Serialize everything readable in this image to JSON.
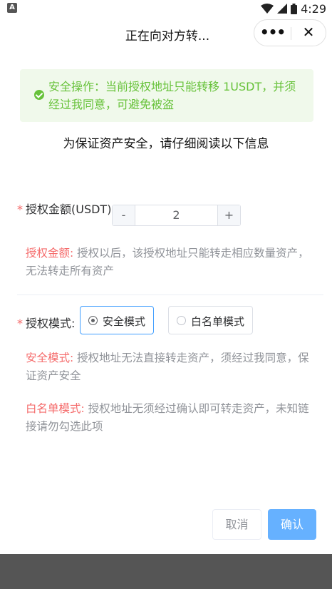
{
  "status_bar": {
    "time": "4:29"
  },
  "nav": {
    "title": "正在向对方转...",
    "more_icon": "more-icon",
    "close_icon": "close-icon"
  },
  "notice": {
    "text": "安全操作：当前授权地址只能转移 1USDT，并须经过我同意，可避免被盗",
    "icon": "check-circle-icon",
    "color": "#67c23a"
  },
  "subtitle": "为保证资产安全，请仔细阅读以下信息",
  "amount": {
    "required_mark": "*",
    "label": "授权金额(USDT):",
    "minus": "-",
    "plus": "+",
    "value": "2",
    "desc_highlight": "授权金额:",
    "desc_text": " 授权以后，该授权地址只能转走相应数量资产，无法转走所有资产"
  },
  "mode": {
    "required_mark": "*",
    "label": "授权模式:",
    "options": [
      {
        "label": "安全模式",
        "selected": true
      },
      {
        "label": "白名单模式",
        "selected": false
      }
    ],
    "safe_highlight": "安全模式:",
    "safe_text": " 授权地址无法直接转走资产，须经过我同意，保证资产安全",
    "white_highlight": "白名单模式:",
    "white_text": " 授权地址无须经过确认即可转走资产，未知链接请勿勾选此项"
  },
  "buttons": {
    "cancel": "取消",
    "confirm": "确认"
  },
  "colors": {
    "accent": "#409eff",
    "danger": "#f56c6c",
    "success": "#67c23a"
  }
}
